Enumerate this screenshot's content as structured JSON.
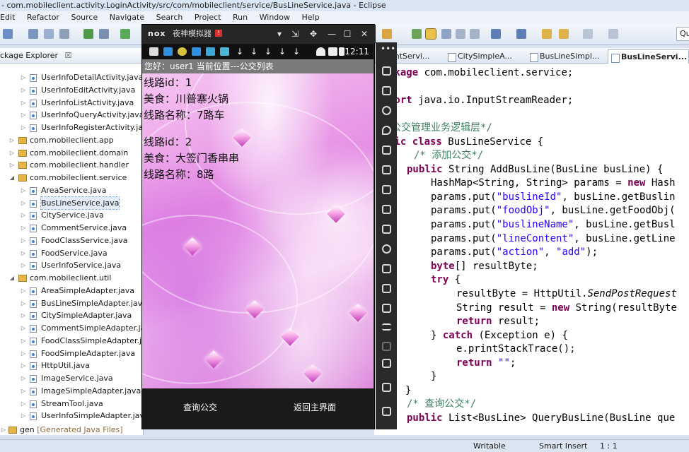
{
  "window": {
    "title": " - com.mobileclient.activity.LoginActivity/src/com/mobileclient/service/BusLineService.java - Eclipse"
  },
  "menu": [
    "Edit",
    "Refactor",
    "Source",
    "Navigate",
    "Search",
    "Project",
    "Run",
    "Window",
    "Help"
  ],
  "quick_access": "Qu",
  "explorer": {
    "title": "ckage Explorer",
    "tab_close": "☒",
    "items": [
      {
        "label": "UserInfoDetailActivity.java",
        "kind": "file",
        "indent": 2
      },
      {
        "label": "UserInfoEditActivity.java",
        "kind": "file",
        "indent": 2
      },
      {
        "label": "UserInfoListActivity.java",
        "kind": "file",
        "indent": 2
      },
      {
        "label": "UserInfoQueryActivity.java",
        "kind": "file",
        "indent": 2
      },
      {
        "label": "UserInfoRegisterActivity.java",
        "kind": "file",
        "indent": 2
      },
      {
        "label": "com.mobileclient.app",
        "kind": "pkg",
        "indent": 1,
        "arrow": "▷"
      },
      {
        "label": "com.mobileclient.domain",
        "kind": "pkg",
        "indent": 1,
        "arrow": "▷"
      },
      {
        "label": "com.mobileclient.handler",
        "kind": "pkg",
        "indent": 1,
        "arrow": "▷"
      },
      {
        "label": "com.mobileclient.service",
        "kind": "pkg",
        "indent": 1,
        "arrow": "◢"
      },
      {
        "label": "AreaService.java",
        "kind": "file",
        "indent": 2
      },
      {
        "label": "BusLineService.java",
        "kind": "file",
        "indent": 2,
        "selected": true
      },
      {
        "label": "CityService.java",
        "kind": "file",
        "indent": 2
      },
      {
        "label": "CommentService.java",
        "kind": "file",
        "indent": 2
      },
      {
        "label": "FoodClassService.java",
        "kind": "file",
        "indent": 2
      },
      {
        "label": "FoodService.java",
        "kind": "file",
        "indent": 2
      },
      {
        "label": "UserInfoService.java",
        "kind": "file",
        "indent": 2
      },
      {
        "label": "com.mobileclient.util",
        "kind": "pkg",
        "indent": 1,
        "arrow": "◢"
      },
      {
        "label": "AreaSimpleAdapter.java",
        "kind": "file",
        "indent": 2
      },
      {
        "label": "BusLineSimpleAdapter.java",
        "kind": "file",
        "indent": 2
      },
      {
        "label": "CitySimpleAdapter.java",
        "kind": "file",
        "indent": 2
      },
      {
        "label": "CommentSimpleAdapter.java",
        "kind": "file",
        "indent": 2
      },
      {
        "label": "FoodClassSimpleAdapter.java",
        "kind": "file",
        "indent": 2
      },
      {
        "label": "FoodSimpleAdapter.java",
        "kind": "file",
        "indent": 2
      },
      {
        "label": "HttpUtil.java",
        "kind": "file",
        "indent": 2
      },
      {
        "label": "ImageService.java",
        "kind": "file",
        "indent": 2
      },
      {
        "label": "ImageSimpleAdapter.java",
        "kind": "file",
        "indent": 2
      },
      {
        "label": "StreamTool.java",
        "kind": "file",
        "indent": 2
      },
      {
        "label": "UserInfoSimpleAdapter.java",
        "kind": "file",
        "indent": 2
      }
    ],
    "gen": {
      "label": "gen",
      "hint": "[Generated Java Files]"
    }
  },
  "editor": {
    "tabs": [
      "entServi...",
      "CitySimpleA...",
      "BusLineSimpl...",
      "BusLineServi..."
    ],
    "active_tab": 3,
    "tab_close": "☒"
  },
  "emulator": {
    "logo": "nox",
    "name": "夜神模拟器",
    "badge": "!",
    "controls": [
      "▾",
      "⇲",
      "✥",
      "—",
      "☐",
      "✕"
    ],
    "clock": "12:11",
    "download_arrows": [
      "↓",
      "↓",
      "↓",
      "↓",
      "↓"
    ]
  },
  "app": {
    "header": "您好：user1  当前位置---公交列表",
    "routes": [
      {
        "id_line": "线路id：1",
        "food_line": "美食：川普寨火锅",
        "name_line": "线路名称：7路车"
      },
      {
        "id_line": "线路id：2",
        "food_line": "美食：大签门香串串",
        "name_line": "线路名称：8路"
      }
    ],
    "buttons": {
      "query": "查询公交",
      "back": "返回主界面"
    }
  },
  "status": {
    "writable": "Writable",
    "insert_mode": "Smart Insert",
    "position": "1 : 1"
  },
  "colors": {
    "keyword": "#7f0055",
    "string": "#2a00ff",
    "comment": "#3f7f5f",
    "app_bar": "#7a7a7a",
    "emulator_frame": "#2a2a2a"
  }
}
